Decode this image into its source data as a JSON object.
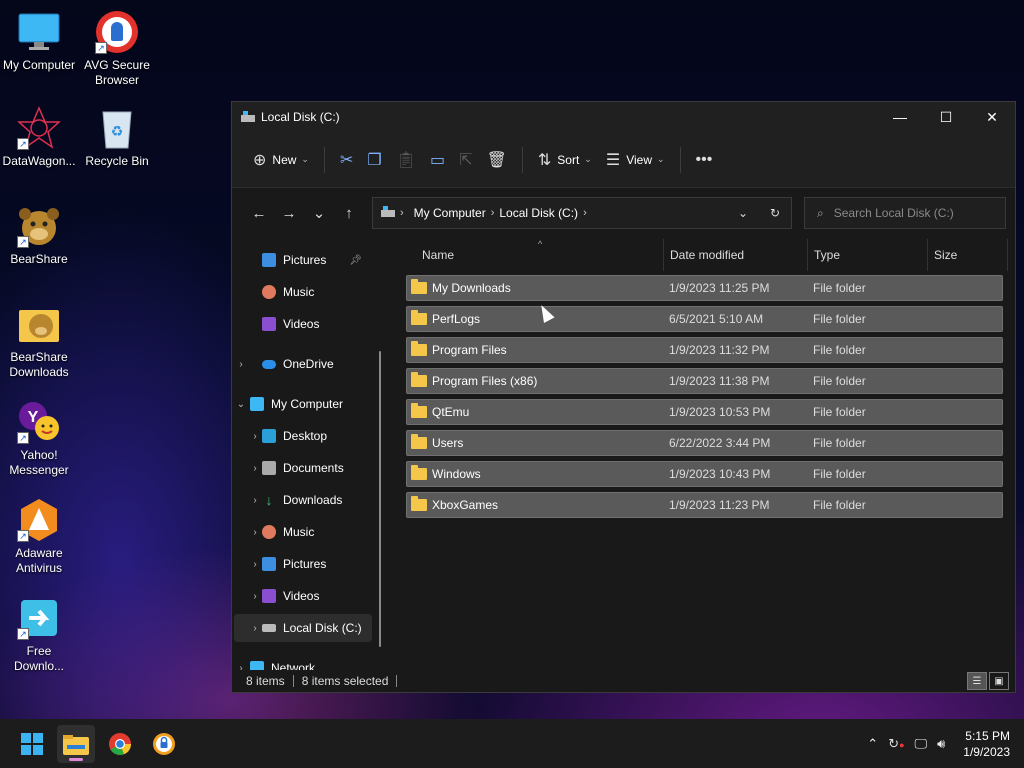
{
  "desktop": {
    "icons": [
      {
        "label": "My Computer"
      },
      {
        "label": "AVG Secure Browser"
      },
      {
        "label": "DataWagon..."
      },
      {
        "label": "Recycle Bin"
      },
      {
        "label": "BearShare"
      },
      {
        "label": "BearShare Downloads"
      },
      {
        "label": "Yahoo! Messenger"
      },
      {
        "label": "Adaware Antivirus"
      },
      {
        "label": "Free Downlo..."
      }
    ]
  },
  "window": {
    "title": "Local Disk (C:)",
    "toolbar": {
      "new_label": "New",
      "sort_label": "Sort",
      "view_label": "View"
    },
    "address": {
      "crumbs": [
        "My Computer",
        "Local Disk (C:)"
      ]
    },
    "search": {
      "placeholder": "Search Local Disk (C:)"
    },
    "nav": {
      "items": [
        {
          "label": "Pictures"
        },
        {
          "label": "Music"
        },
        {
          "label": "Videos"
        },
        {
          "label": "OneDrive"
        },
        {
          "label": "My Computer"
        },
        {
          "label": "Desktop"
        },
        {
          "label": "Documents"
        },
        {
          "label": "Downloads"
        },
        {
          "label": "Music"
        },
        {
          "label": "Pictures"
        },
        {
          "label": "Videos"
        },
        {
          "label": "Local Disk (C:)"
        },
        {
          "label": "Network"
        }
      ]
    },
    "columns": {
      "name": "Name",
      "date": "Date modified",
      "type": "Type",
      "size": "Size"
    },
    "files": [
      {
        "name": "My Downloads",
        "date": "1/9/2023 11:25 PM",
        "type": "File folder"
      },
      {
        "name": "PerfLogs",
        "date": "6/5/2021 5:10 AM",
        "type": "File folder"
      },
      {
        "name": "Program Files",
        "date": "1/9/2023 11:32 PM",
        "type": "File folder"
      },
      {
        "name": "Program Files (x86)",
        "date": "1/9/2023 11:38 PM",
        "type": "File folder"
      },
      {
        "name": "QtEmu",
        "date": "1/9/2023 10:53 PM",
        "type": "File folder"
      },
      {
        "name": "Users",
        "date": "6/22/2022 3:44 PM",
        "type": "File folder"
      },
      {
        "name": "Windows",
        "date": "1/9/2023 10:43 PM",
        "type": "File folder"
      },
      {
        "name": "XboxGames",
        "date": "1/9/2023 11:23 PM",
        "type": "File folder"
      }
    ],
    "status": {
      "count": "8 items",
      "selected": "8 items selected"
    }
  },
  "taskbar": {
    "clock_time": "5:15 PM",
    "clock_date": "1/9/2023"
  },
  "colors": {
    "accent": "#0078d4",
    "folder": "#f4c64a",
    "selection": "#5a5a5a"
  }
}
